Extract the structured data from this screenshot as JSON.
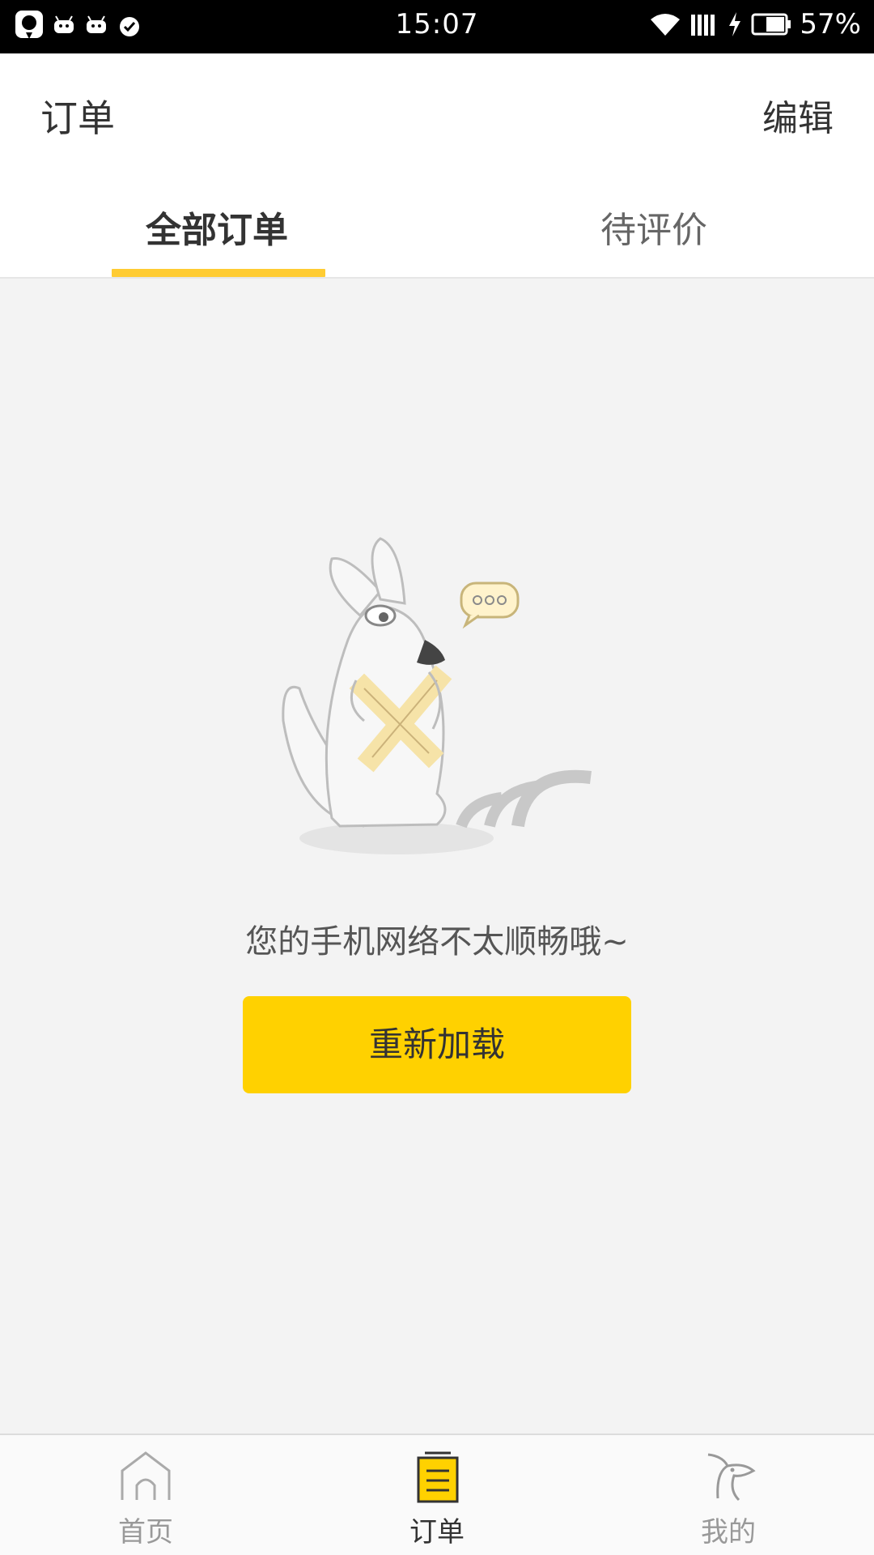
{
  "status_bar": {
    "time": "15:07",
    "battery": "57%",
    "icons": [
      "baidu-map-icon",
      "android-icon",
      "android-icon",
      "alarm-icon",
      "wifi-icon",
      "signal-icon",
      "charging-icon",
      "battery-icon"
    ]
  },
  "header": {
    "title": "订单",
    "edit_label": "编辑"
  },
  "tabs": {
    "all_orders": "全部订单",
    "pending_review": "待评价",
    "active": "all_orders",
    "accent_color": "#ffcc33"
  },
  "empty_state": {
    "illustration": "kangaroo-no-network-illustration",
    "message": "您的手机网络不太顺畅哦~",
    "reload_label": "重新加载",
    "button_color": "#ffd100"
  },
  "bottom_nav": {
    "home": "首页",
    "orders": "订单",
    "mine": "我的",
    "active": "orders"
  }
}
